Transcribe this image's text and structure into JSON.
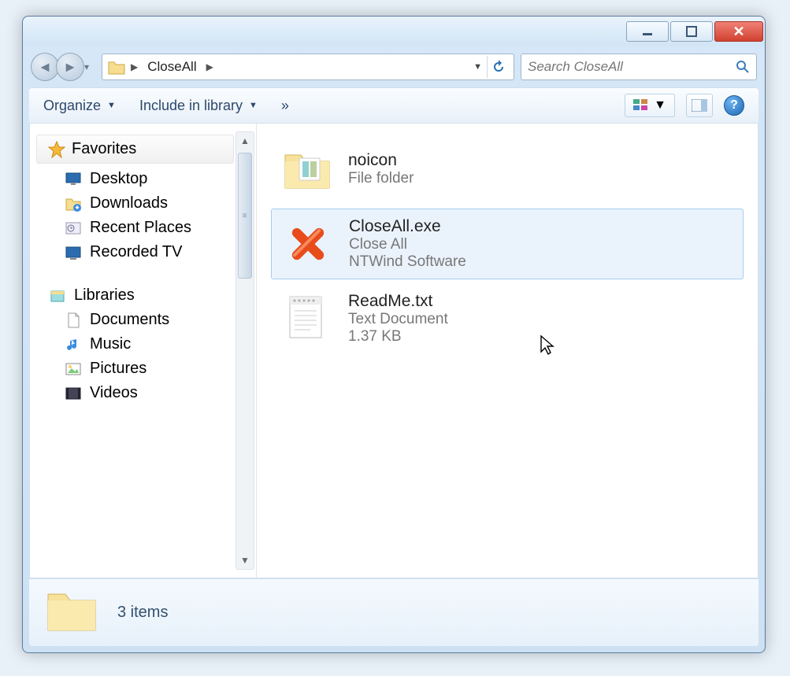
{
  "breadcrumb": {
    "folder": "CloseAll"
  },
  "search": {
    "placeholder": "Search CloseAll"
  },
  "toolbar": {
    "organize": "Organize",
    "include": "Include in library",
    "more": "»"
  },
  "sidebar": {
    "favorites_label": "Favorites",
    "favorites": [
      {
        "label": "Desktop"
      },
      {
        "label": "Downloads"
      },
      {
        "label": "Recent Places"
      },
      {
        "label": "Recorded TV"
      }
    ],
    "libraries_label": "Libraries",
    "libraries": [
      {
        "label": "Documents"
      },
      {
        "label": "Music"
      },
      {
        "label": "Pictures"
      },
      {
        "label": "Videos"
      }
    ]
  },
  "files": [
    {
      "name": "noicon",
      "line1": "File folder",
      "line2": ""
    },
    {
      "name": "CloseAll.exe",
      "line1": "Close All",
      "line2": "NTWind Software"
    },
    {
      "name": "ReadMe.txt",
      "line1": "Text Document",
      "line2": "1.37 KB"
    }
  ],
  "status": {
    "text": "3 items"
  }
}
